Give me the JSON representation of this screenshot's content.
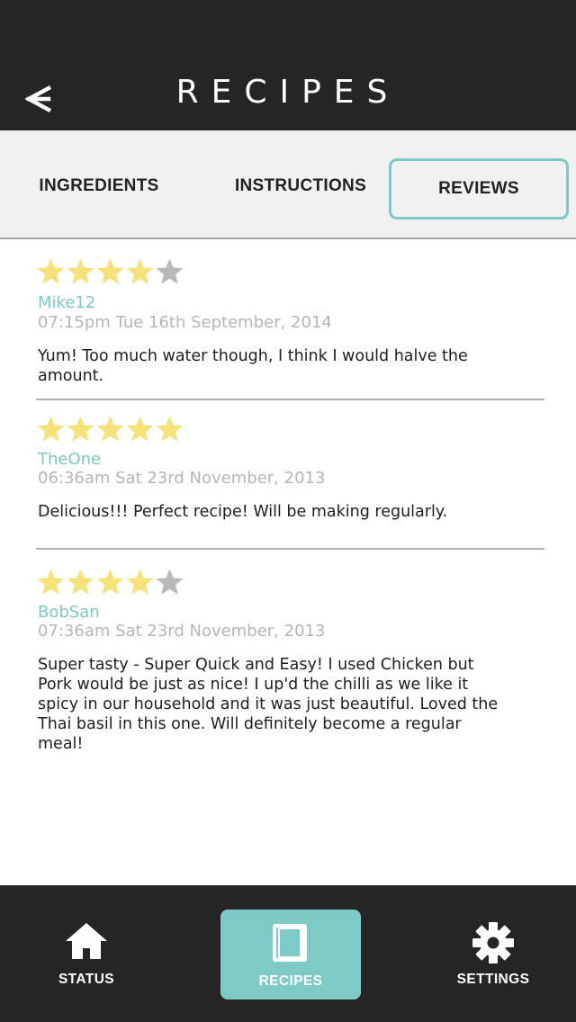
{
  "header": {
    "title": "RECIPES"
  },
  "tabs": [
    {
      "label": "INGREDIENTS",
      "active": false
    },
    {
      "label": "INSTRUCTIONS",
      "active": false
    },
    {
      "label": "REVIEWS",
      "active": true
    }
  ],
  "reviews": [
    {
      "rating": 4,
      "author": "Mike12",
      "date": "07:15pm Tue 16th September, 2014",
      "text": "Yum! Too much water though, I think I would halve the amount."
    },
    {
      "rating": 5,
      "author": "TheOne",
      "date": "06:36am Sat 23rd November, 2013",
      "text": "Delicious!!! Perfect recipe! Will be making regularly."
    },
    {
      "rating": 4,
      "author": "BobSan",
      "date": "07:36am Sat 23rd November, 2013",
      "text": "Super tasty - Super Quick and Easy! I used Chicken but Pork would be just as nice! I up'd the chilli as we like it spicy in our household and it was just beautiful. Loved the Thai basil in this one. Will definitely become a regular meal!"
    }
  ],
  "nav": [
    {
      "label": "STATUS",
      "icon": "home-icon",
      "active": false
    },
    {
      "label": "RECIPES",
      "icon": "recipe-book-icon",
      "active": true
    },
    {
      "label": "SETTINGS",
      "icon": "gear-icon",
      "active": false
    }
  ],
  "colors": {
    "accent": "#7ecac6",
    "star_filled": "#f5e27a",
    "star_empty": "#b9b9b9",
    "bar": "#252525"
  }
}
